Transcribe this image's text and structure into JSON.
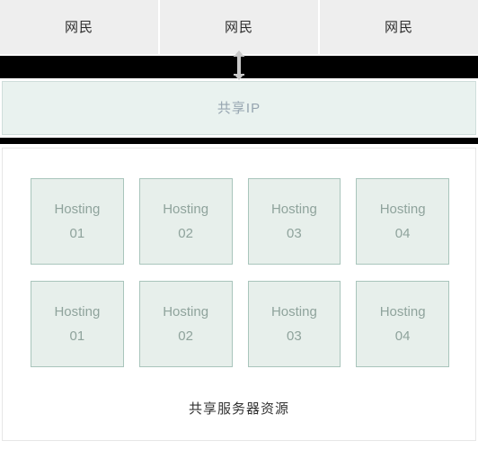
{
  "diagram": {
    "netizens": {
      "cells": [
        {
          "label": "网民"
        },
        {
          "label": "网民"
        },
        {
          "label": "网民"
        }
      ]
    },
    "connector": {
      "arrow_icon": "arrow-up-down-icon",
      "arrow_color": "#c9c9c9",
      "band_color": "#000000"
    },
    "shared_ip": {
      "label": "共享IP",
      "background": "#e9f2ef",
      "border": "#cfdedb",
      "text_color": "#96a5b0"
    },
    "server_pool": {
      "caption": "共享服务器资源",
      "box_background": "#e7efeb",
      "box_border": "#a9c5bc",
      "box_text_color": "#8fa39c",
      "rows": [
        [
          {
            "name": "Hosting",
            "number": "01"
          },
          {
            "name": "Hosting",
            "number": "02"
          },
          {
            "name": "Hosting",
            "number": "03"
          },
          {
            "name": "Hosting",
            "number": "04"
          }
        ],
        [
          {
            "name": "Hosting",
            "number": "01"
          },
          {
            "name": "Hosting",
            "number": "02"
          },
          {
            "name": "Hosting",
            "number": "03"
          },
          {
            "name": "Hosting",
            "number": "04"
          }
        ]
      ]
    }
  }
}
